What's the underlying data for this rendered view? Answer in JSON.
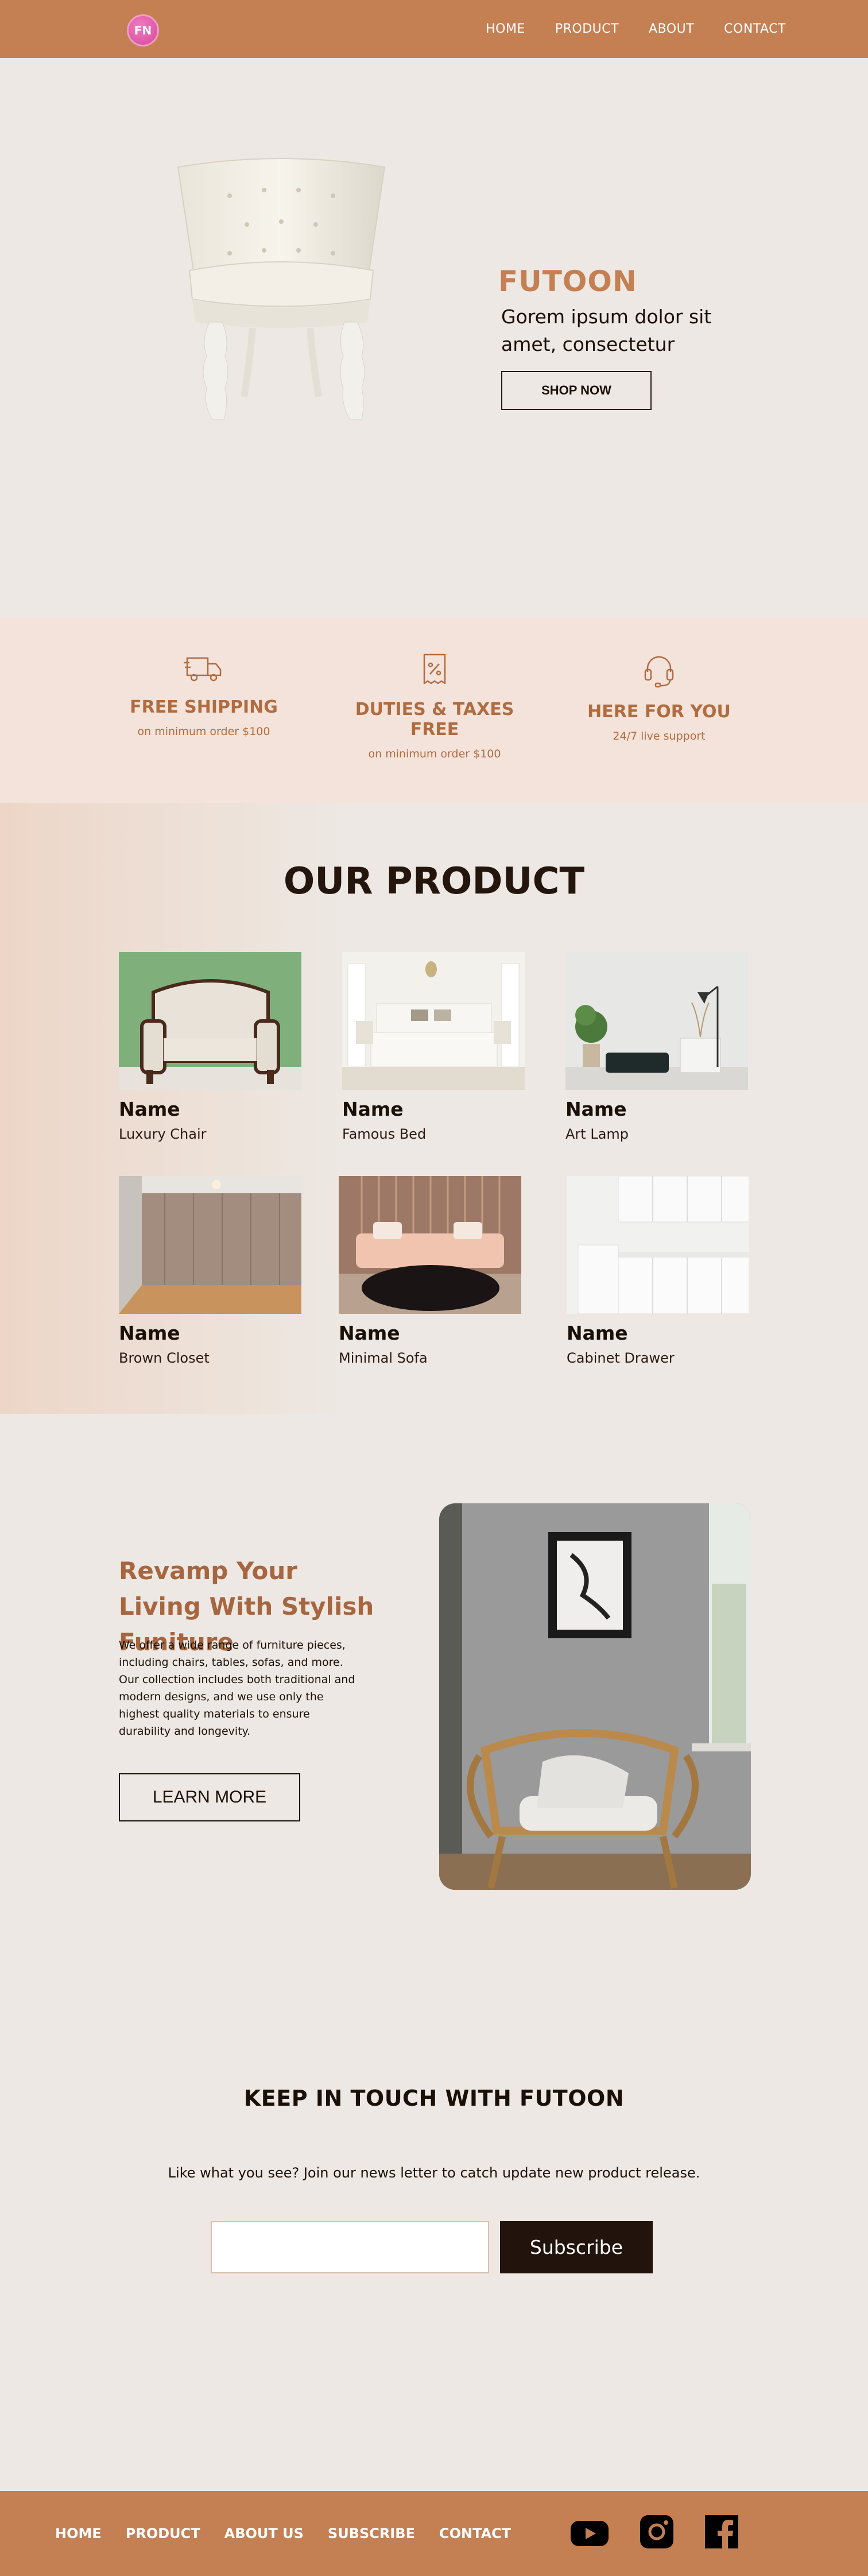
{
  "nav": {
    "logo": "FN",
    "links": [
      "HOME",
      "PRODUCT",
      "ABOUT",
      "CONTACT"
    ]
  },
  "hero": {
    "title": "FUTOON",
    "subtitle": "Gorem ipsum dolor sit amet, consectetur",
    "button": "SHOP NOW"
  },
  "features": [
    {
      "icon": "truck-icon",
      "title": "FREE SHIPPING",
      "sub": "on minimum order $100"
    },
    {
      "icon": "receipt-percent-icon",
      "title": "DUTIES & TAXES FREE",
      "sub": "on minimum order $100"
    },
    {
      "icon": "headset-icon",
      "title": "HERE FOR YOU",
      "sub": "24/7 live support"
    }
  ],
  "products": {
    "title": "OUR PRODUCT",
    "items": [
      {
        "name": "Name",
        "desc": "Luxury Chair"
      },
      {
        "name": "Name",
        "desc": "Famous Bed"
      },
      {
        "name": "Name",
        "desc": "Art Lamp"
      },
      {
        "name": "Name",
        "desc": "Brown Closet"
      },
      {
        "name": "Name",
        "desc": "Minimal Sofa"
      },
      {
        "name": "Name",
        "desc": "Cabinet Drawer"
      }
    ]
  },
  "revamp": {
    "title": "Revamp Your Living With Stylish Funiture",
    "text": "We offer a wide range of furniture pieces, including chairs, tables, sofas, and more. Our collection includes both traditional and modern designs, and we use only the highest quality materials to ensure durability and longevity.",
    "button": "LEARN MORE"
  },
  "newsletter": {
    "title": "KEEP IN TOUCH WITH FUTOON",
    "text": "Like what you see? Join our news letter to catch update new product release.",
    "input_value": "",
    "button": "Subscribe"
  },
  "footer": {
    "links": [
      "HOME",
      "PRODUCT",
      "ABOUT US",
      "SUBSCRIBE",
      "CONTACT"
    ],
    "social": [
      "youtube-icon",
      "instagram-icon",
      "facebook-icon"
    ]
  },
  "colors": {
    "brand": "#c47f52",
    "accent_text": "#b06c40",
    "background": "#ede8e3",
    "feature_band": "#f4e3da",
    "dark": "#22140c"
  }
}
